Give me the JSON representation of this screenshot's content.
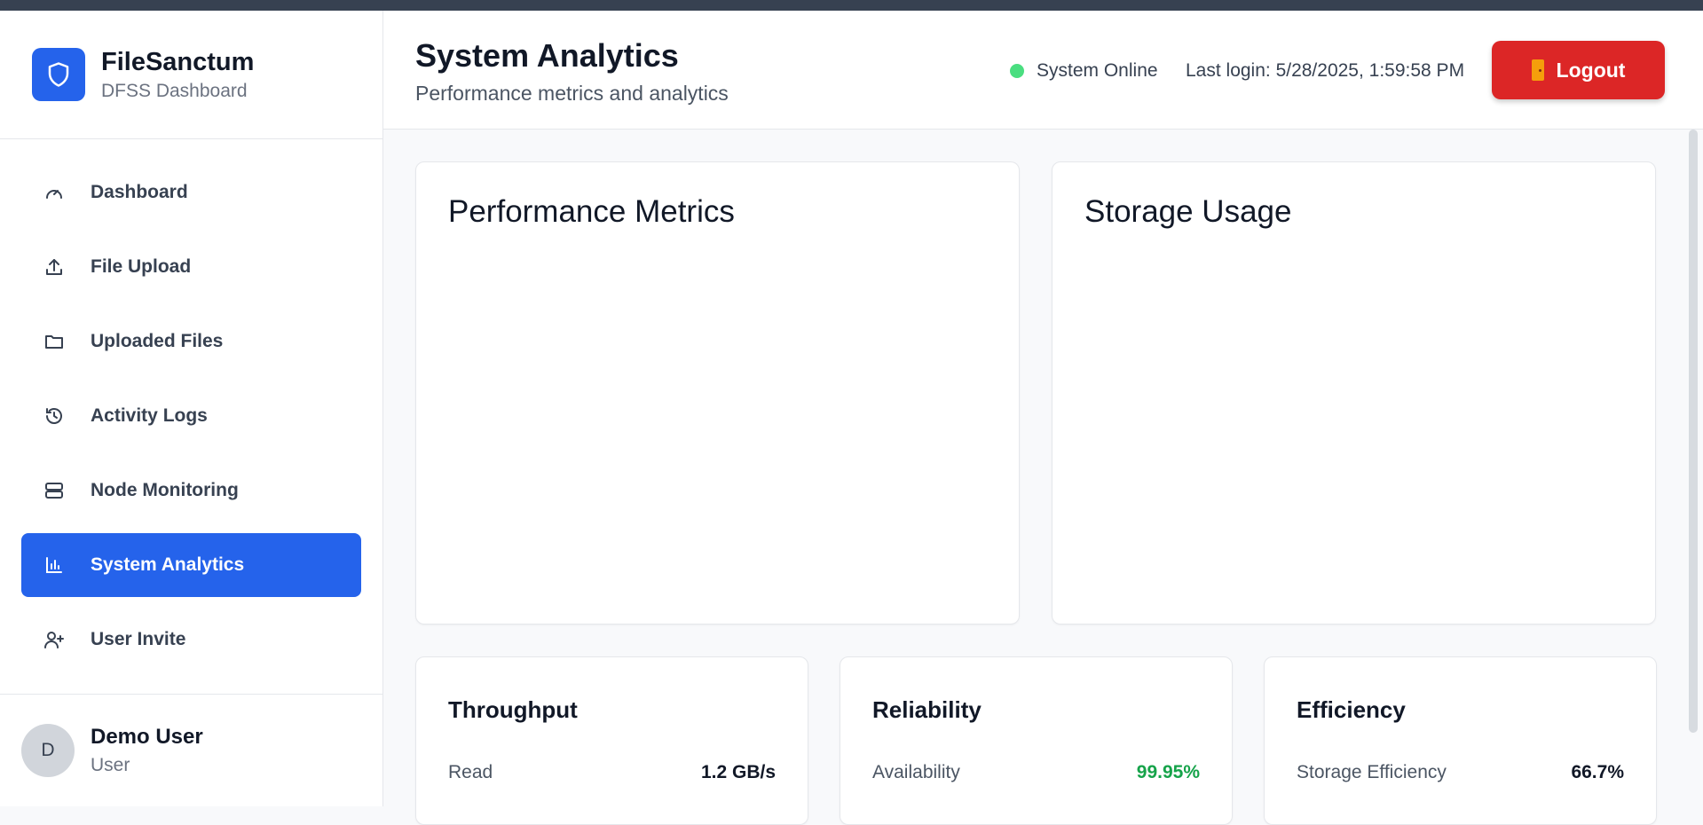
{
  "app": {
    "name": "FileSanctum",
    "subtitle": "DFSS Dashboard"
  },
  "sidebar": {
    "items": [
      {
        "label": "Dashboard",
        "icon": "gauge-icon"
      },
      {
        "label": "File Upload",
        "icon": "upload-icon"
      },
      {
        "label": "Uploaded Files",
        "icon": "folder-icon"
      },
      {
        "label": "Activity Logs",
        "icon": "history-icon"
      },
      {
        "label": "Node Monitoring",
        "icon": "server-icon"
      },
      {
        "label": "System Analytics",
        "icon": "bar-chart-icon",
        "active": true
      },
      {
        "label": "User Invite",
        "icon": "user-plus-icon"
      }
    ]
  },
  "user": {
    "initial": "D",
    "name": "Demo User",
    "role": "User"
  },
  "header": {
    "title": "System Analytics",
    "subtitle": "Performance metrics and analytics",
    "status": "System Online",
    "last_login": "Last login: 5/28/2025, 1:59:58 PM",
    "logout_label": "Logout"
  },
  "panels": {
    "performance_title": "Performance Metrics",
    "storage_title": "Storage Usage"
  },
  "stats": {
    "throughput": {
      "title": "Throughput",
      "label": "Read",
      "value": "1.2 GB/s"
    },
    "reliability": {
      "title": "Reliability",
      "label": "Availability",
      "value": "99.95%"
    },
    "efficiency": {
      "title": "Efficiency",
      "label": "Storage Efficiency",
      "value": "66.7%"
    }
  },
  "colors": {
    "primary": "#2563eb",
    "danger": "#dc2626",
    "online": "#4ade80",
    "success": "#16a34a"
  }
}
